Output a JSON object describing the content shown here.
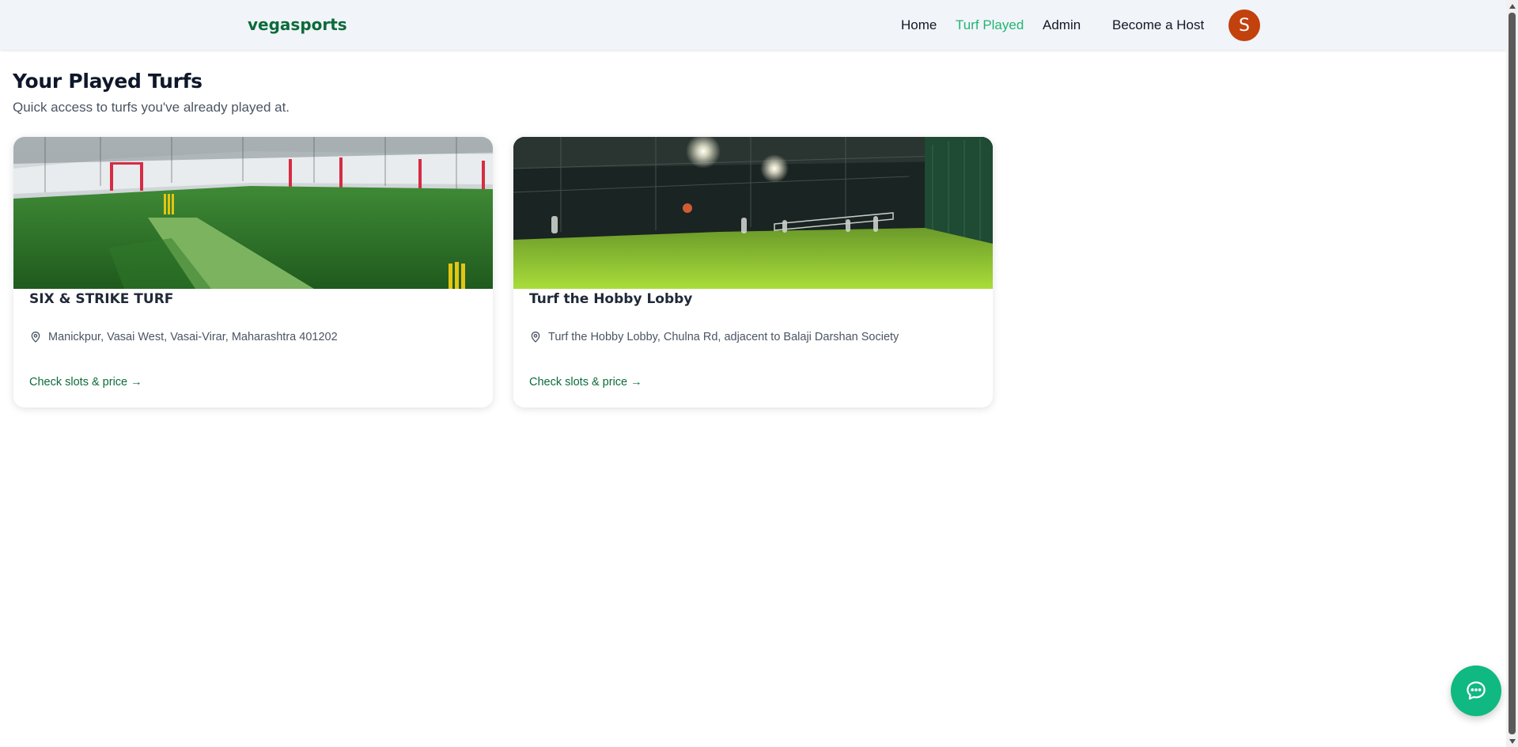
{
  "nav": {
    "brand": "vegasports",
    "links": [
      {
        "label": "Home",
        "active": false
      },
      {
        "label": "Turf Played",
        "active": true
      },
      {
        "label": "Admin",
        "active": false
      },
      {
        "label": "Become a Host",
        "active": false
      }
    ],
    "avatar_initial": "S",
    "avatar_color": "#c2410c"
  },
  "page": {
    "title": "Your Played Turfs",
    "subtitle": "Quick access to turfs you've already played at."
  },
  "cards": [
    {
      "name": "SIX & STRIKE TURF",
      "address": "Manickpur, Vasai West, Vasai-Virar, Maharashtra 401202",
      "link_label": "Check slots & price →",
      "image_icon": "outdoor-cricket-turf-photo"
    },
    {
      "name": "Turf the Hobby Lobby",
      "address": "Turf the Hobby Lobby, Chulna Rd, adjacent to Balaji Darshan Society",
      "link_label": "Check slots & price →",
      "image_icon": "night-floodlit-turf-photo"
    }
  ],
  "chat": {
    "icon": "chat-bubble-icon"
  },
  "colors": {
    "brand": "#0b6b3a",
    "active_link": "#22b573",
    "chat_fab": "#10b981"
  }
}
